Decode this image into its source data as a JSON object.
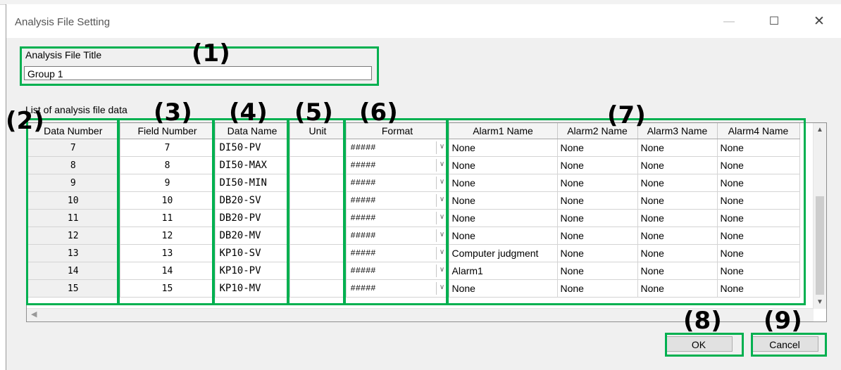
{
  "window": {
    "title": "Analysis File Setting",
    "min_glyph": "—",
    "max_glyph": "☐",
    "close_glyph": "✕"
  },
  "analysis_file_title": {
    "label": "Analysis File Title",
    "value": "Group 1"
  },
  "list": {
    "label": "List of analysis file data",
    "columns": [
      "Data Number",
      "Field Number",
      "Data Name",
      "Unit",
      "Format",
      "Alarm1 Name",
      "Alarm2 Name",
      "Alarm3 Name",
      "Alarm4 Name"
    ],
    "rows": [
      {
        "number": "7",
        "field": "7",
        "name": "DI50-PV",
        "unit": "",
        "format": "#####",
        "alarm1": "None",
        "alarm2": "None",
        "alarm3": "None",
        "alarm4": "None"
      },
      {
        "number": "8",
        "field": "8",
        "name": "DI50-MAX",
        "unit": "",
        "format": "#####",
        "alarm1": "None",
        "alarm2": "None",
        "alarm3": "None",
        "alarm4": "None"
      },
      {
        "number": "9",
        "field": "9",
        "name": "DI50-MIN",
        "unit": "",
        "format": "#####",
        "alarm1": "None",
        "alarm2": "None",
        "alarm3": "None",
        "alarm4": "None"
      },
      {
        "number": "10",
        "field": "10",
        "name": "DB20-SV",
        "unit": "",
        "format": "#####",
        "alarm1": "None",
        "alarm2": "None",
        "alarm3": "None",
        "alarm4": "None"
      },
      {
        "number": "11",
        "field": "11",
        "name": "DB20-PV",
        "unit": "",
        "format": "#####",
        "alarm1": "None",
        "alarm2": "None",
        "alarm3": "None",
        "alarm4": "None"
      },
      {
        "number": "12",
        "field": "12",
        "name": "DB20-MV",
        "unit": "",
        "format": "#####",
        "alarm1": "None",
        "alarm2": "None",
        "alarm3": "None",
        "alarm4": "None"
      },
      {
        "number": "13",
        "field": "13",
        "name": "KP10-SV",
        "unit": "",
        "format": "#####",
        "alarm1": "Computer judgment",
        "alarm2": "None",
        "alarm3": "None",
        "alarm4": "None"
      },
      {
        "number": "14",
        "field": "14",
        "name": "KP10-PV",
        "unit": "",
        "format": "#####",
        "alarm1": "Alarm1",
        "alarm2": "None",
        "alarm3": "None",
        "alarm4": "None"
      },
      {
        "number": "15",
        "field": "15",
        "name": "KP10-MV",
        "unit": "",
        "format": "#####",
        "alarm1": "None",
        "alarm2": "None",
        "alarm3": "None",
        "alarm4": "None"
      }
    ]
  },
  "buttons": {
    "ok": "OK",
    "cancel": "Cancel"
  },
  "callouts": [
    "(1)",
    "(2)",
    "(3)",
    "(4)",
    "(5)",
    "(6)",
    "(7)",
    "(8)",
    "(9)"
  ],
  "colors": {
    "highlight": "#00b050",
    "window_bg": "#f0f0f0",
    "header_bg": "#f4f4f4",
    "number_col_bg": "#f0f0f0"
  }
}
